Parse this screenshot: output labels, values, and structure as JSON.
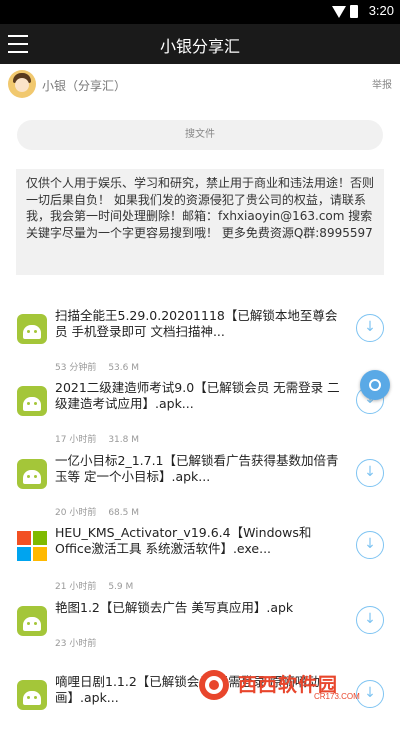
{
  "status_bar": {
    "time": "3:20"
  },
  "app_bar": {
    "title": "小银分享汇",
    "menu_icon": "hamburger-menu-icon"
  },
  "profile": {
    "name": "小银（分享汇）",
    "report_label": "举报"
  },
  "search": {
    "label": "搜文件"
  },
  "notice": {
    "text": "仅供个人用于娱乐、学习和研究，禁止用于商业和违法用途！否则一切后果自负！ 如果我们发的资源侵犯了贵公司的权益，请联系我，我会第一时间处理删除！邮箱：fxhxiaoyin@163.com 搜索关键字尽量为一个字更容易搜到哦！ 更多免费资源Q群:8995597"
  },
  "files": [
    {
      "title": "扫描全能王5.29.0.20201118【已解锁本地至尊会员 手机登录即可 文档扫描神...",
      "time": "53 分钟前",
      "size": "53.6 M",
      "icon": "android-icon"
    },
    {
      "title": "2021二级建造师考试9.0【已解锁会员 无需登录 二级建造考试应用】.apk...",
      "time": "17 小时前",
      "size": "31.8 M",
      "icon": "android-icon"
    },
    {
      "title": "一亿小目标2_1.7.1【已解锁看广告获得基数加倍青玉等 定一个小目标】.apk...",
      "time": "20 小时前",
      "size": "68.5 M",
      "icon": "android-icon"
    },
    {
      "title": "HEU_KMS_Activator_v19.6.4【Windows和Office激活工具 系统激活软件】.exe...",
      "time": "21 小时前",
      "size": "5.9 M",
      "icon": "windows-icon"
    },
    {
      "title": "艳图1.2【已解锁去广告 美写真应用】.apk",
      "time": "23 小时前",
      "size": "",
      "icon": "android-icon"
    },
    {
      "title": "嘀哩日剧1.1.2【已解锁会员 无需登录 原嘀嘀动画】.apk...",
      "time": "",
      "size": "",
      "icon": "android-icon"
    }
  ],
  "watermark": {
    "text": "西西软件园",
    "url": "CR173.COM"
  }
}
